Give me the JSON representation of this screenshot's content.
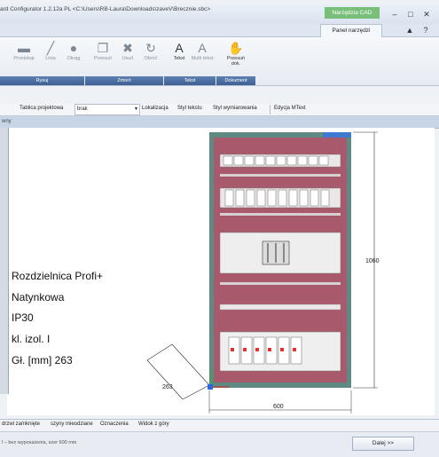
{
  "window": {
    "title": "ard Configurator 1.2.12a PL <C:\\Users\\RB-Laura\\Downloads\\zaveV\\Brecznie.sbc>",
    "context_tab": "Narzędzia CAD",
    "active_tab": "Panel narzędzi",
    "minimize": "–",
    "restore": "□",
    "close": "✕",
    "help": "?",
    "collapse": "▲"
  },
  "ribbon": {
    "buttons": [
      {
        "label": "Prostokąt",
        "icon": "rectangle-icon",
        "glyph": "▬"
      },
      {
        "label": "Linia",
        "icon": "line-icon",
        "glyph": "╱"
      },
      {
        "label": "Okrąg",
        "icon": "circle-icon",
        "glyph": "●"
      },
      {
        "label": "Przesuń",
        "icon": "move-icon",
        "glyph": "❐"
      },
      {
        "label": "Usuń",
        "icon": "delete-icon",
        "glyph": "✖"
      },
      {
        "label": "Obróć",
        "icon": "rotate-icon",
        "glyph": "↻"
      },
      {
        "label": "Tekst",
        "icon": "text-icon",
        "glyph": "A"
      },
      {
        "label": "Multi tekst",
        "icon": "multiline-text-icon",
        "glyph": "A"
      },
      {
        "label": "Przesuń dok.",
        "icon": "pan-hand-icon",
        "glyph": "✋"
      }
    ],
    "groups": [
      "Rysuj",
      "Zmień",
      "Tekst",
      "Dokument"
    ]
  },
  "toolbar": {
    "table_label": "Tablica projektowa",
    "table_value": "brak",
    "location": "Lokalizacja",
    "text_style": "Styl tekstu",
    "dim_style": "Styl wymiarowania",
    "mtext": "Edycja MText"
  },
  "panel": {
    "header": "wny"
  },
  "drawing": {
    "info_lines": [
      "Rozdzielnica Profi+",
      "Natynkowa",
      "IP30",
      "kl. izol. I",
      "Gł. [mm] 263"
    ],
    "dim_height": "1060",
    "dim_width": "600",
    "dim_depth": "263"
  },
  "bottom_tabs": [
    "drzwi zamknięte",
    "szyny mieodziane",
    "Oznaczenia",
    "Widok z góry"
  ],
  "status": {
    "text": "l – bez wyposażenia, szer 600 mm",
    "next_button": "Dalej >>"
  },
  "colors": {
    "cabinet_fill": "#a85a6c",
    "cabinet_frame": "#2e4a44",
    "context_tab": "#78c07a",
    "group_label": "#4a6aa0"
  }
}
